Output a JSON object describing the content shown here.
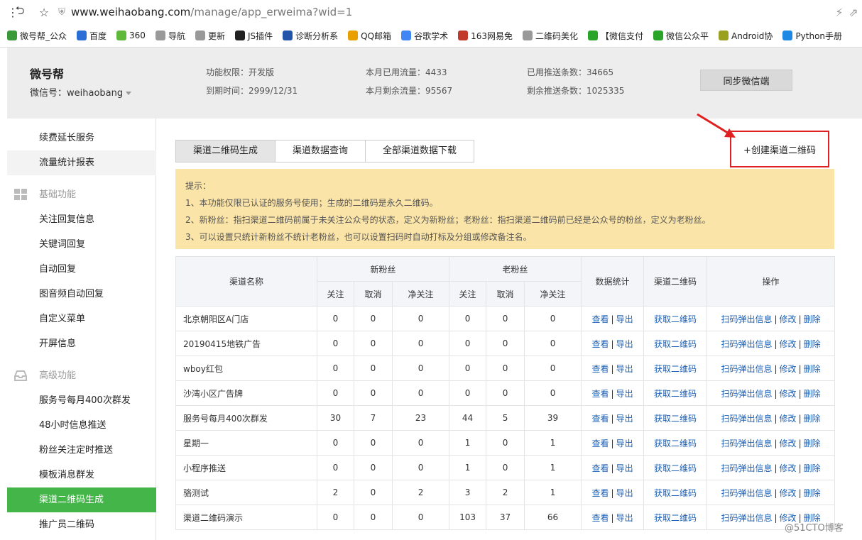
{
  "browser": {
    "url_domain": "www.weihaobang.com",
    "url_path": "/manage/app_erweima?wid=1",
    "bookmarks": [
      "微号帮_公众",
      "百度",
      "360",
      "导航",
      "更新",
      "JS插件",
      "诊断分析系",
      "QQ邮箱",
      "谷歌学术",
      "163网易免",
      "二维码美化",
      "【微信支付",
      "微信公众平",
      "Android协",
      "Python手册"
    ]
  },
  "header": {
    "brand": "微号帮",
    "wxid": "微信号：weihaobang",
    "perm": "功能权限：开发版",
    "expire": "到期时间：2999/12/31",
    "flow_used": "本月已用流量：4433",
    "flow_left": "本月剩余流量：95567",
    "push_used": "已用推送条数：34665",
    "push_left": "剩余推送条数：1025335",
    "sync_button": "同步微信端"
  },
  "sidebar": {
    "top_items": [
      "续费延长服务",
      "流量统计报表"
    ],
    "basic_title": "基础功能",
    "basic_items": [
      "关注回复信息",
      "关键词回复",
      "自动回复",
      "图音频自动回复",
      "自定义菜单",
      "开屏信息"
    ],
    "advanced_title": "高级功能",
    "advanced_items": [
      "服务号每月400次群发",
      "48小时信息推送",
      "粉丝关注定时推送",
      "模板消息群发",
      "渠道二维码生成",
      "推广员二维码"
    ]
  },
  "tabs": [
    "渠道二维码生成",
    "渠道数据查询",
    "全部渠道数据下载"
  ],
  "create_button": "+创建渠道二维码",
  "tips": {
    "title": "提示：",
    "lines": [
      "1、本功能仅限已认证的服务号使用；生成的二维码是永久二维码。",
      "2、新粉丝：指扫渠道二维码前属于未关注公众号的状态，定义为新粉丝；老粉丝：指扫渠道二维码前已经是公众号的粉丝，定义为老粉丝。",
      "3、可以设置只统计新粉丝不统计老粉丝，也可以设置扫码时自动打标及分组或修改备注名。"
    ]
  },
  "table": {
    "headers": {
      "name": "渠道名称",
      "new_fans": "新粉丝",
      "old_fans": "老粉丝",
      "stats": "数据统计",
      "qrcode": "渠道二维码",
      "ops": "操作",
      "follow": "关注",
      "cancel": "取消",
      "net": "净关注"
    },
    "links": {
      "view": "查看",
      "export": "导出",
      "get_qr": "获取二维码",
      "popup": "扫码弹出信息",
      "edit": "修改",
      "delete": "删除"
    },
    "rows": [
      {
        "name": "北京朝阳区A门店",
        "v": [
          0,
          0,
          0,
          0,
          0,
          0
        ]
      },
      {
        "name": "20190415地铁广告",
        "v": [
          0,
          0,
          0,
          0,
          0,
          0
        ]
      },
      {
        "name": "wboy红包",
        "v": [
          0,
          0,
          0,
          0,
          0,
          0
        ]
      },
      {
        "name": "沙湾小区广告牌",
        "v": [
          0,
          0,
          0,
          0,
          0,
          0
        ]
      },
      {
        "name": "服务号每月400次群发",
        "v": [
          30,
          7,
          23,
          44,
          5,
          39
        ]
      },
      {
        "name": "星期一",
        "v": [
          0,
          0,
          0,
          1,
          0,
          1
        ]
      },
      {
        "name": "小程序推送",
        "v": [
          0,
          0,
          0,
          1,
          0,
          1
        ]
      },
      {
        "name": "骆测试",
        "v": [
          2,
          0,
          2,
          3,
          2,
          1
        ]
      },
      {
        "name": "渠道二维码演示",
        "v": [
          0,
          0,
          0,
          103,
          37,
          66
        ]
      }
    ]
  },
  "watermark": "@51CTO博客",
  "colors": {
    "active_green": "#44b549",
    "tips_bg": "#fbe4a7",
    "link_blue": "#1a5fb4",
    "highlight_red": "#e02020"
  }
}
